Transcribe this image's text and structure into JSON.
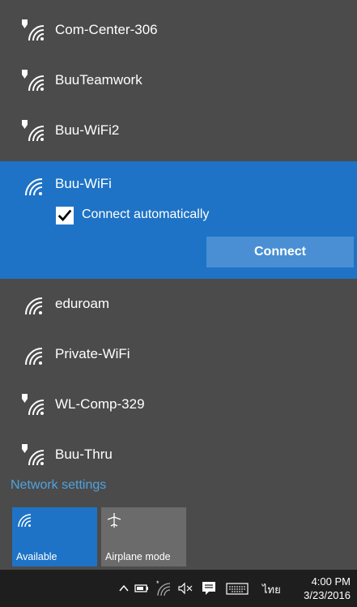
{
  "networks": [
    {
      "name": "Com-Center-306",
      "secured": true
    },
    {
      "name": "BuuTeamwork",
      "secured": true
    },
    {
      "name": "Buu-WiFi2",
      "secured": true
    },
    {
      "name": "eduroam",
      "secured": false
    },
    {
      "name": "Private-WiFi",
      "secured": false
    },
    {
      "name": "WL-Comp-329",
      "secured": true
    },
    {
      "name": "Buu-Thru",
      "secured": true
    }
  ],
  "selected_network": {
    "name": "Buu-WiFi",
    "connect_automatically_label": "Connect automatically",
    "connect_automatically_checked": true,
    "connect_button_label": "Connect"
  },
  "network_settings_label": "Network settings",
  "quick_actions": {
    "available_label": "Available",
    "airplane_label": "Airplane mode"
  },
  "taskbar": {
    "language": "ไทย",
    "time": "4:00 PM",
    "date": "3/23/2016"
  },
  "colors": {
    "panel_bg": "#4b4b4b",
    "accent": "#1e73c6",
    "button": "#4a8fd3",
    "link": "#4fa3e0",
    "taskbar": "#1e1e1e"
  }
}
